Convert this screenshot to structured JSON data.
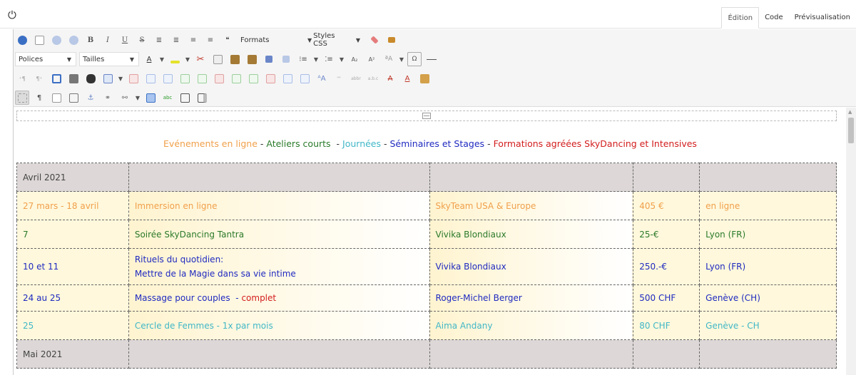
{
  "topbar": {
    "power_icon": "power-icon",
    "tabs": [
      {
        "label": "Édition",
        "active": true
      },
      {
        "label": "Code",
        "active": false
      },
      {
        "label": "Prévisualisation",
        "active": false
      }
    ]
  },
  "toolbar": {
    "formats_label": "Formats",
    "styles_label": "Styles CSS",
    "fonts_label": "Polices",
    "sizes_label": "Tailles",
    "bold": "B",
    "italic": "I",
    "underline": "U",
    "strike": "S",
    "subscript": "A₂",
    "superscript": "A²",
    "omega": "Ω",
    "quote": "❝",
    "pilcrow": "¶",
    "abc": "abc"
  },
  "legend": {
    "online": "Evénements en ligne",
    "short": "Ateliers courts",
    "days": "Journées",
    "seminars": "Séminaires et Stages",
    "trainings": "Formations agréées SkyDancing et Intensives",
    "dash": "-"
  },
  "schedule": {
    "april": "Avril 2021",
    "may": "Mai 2021",
    "rows": [
      {
        "date": "27 mars - 18 avril",
        "title": "Immersion en ligne",
        "host": "SkyTeam USA & Europe",
        "price": "405 €",
        "place": "en ligne"
      },
      {
        "date": "7",
        "title": "Soirée SkyDancing Tantra",
        "host": "Vivika Blondiaux",
        "price": "25-€",
        "place": "Lyon (FR)"
      },
      {
        "date": "10 et 11",
        "title_line1": "Rituels du quotidien:",
        "title_line2": "Mettre de la Magie dans sa vie intime",
        "host": "Vivika Blondiaux",
        "price": "250.-€",
        "place": "Lyon (FR)"
      },
      {
        "date": "24 au 25",
        "title": "Massage pour couples  - ",
        "title_status": "complet",
        "host": "Roger-Michel Berger",
        "price": "500 CHF",
        "place": "Genève (CH)"
      },
      {
        "date": "25",
        "title": "Cercle de Femmes - 1x par mois",
        "host": "Aima Andany",
        "price": "80 CHF",
        "place": "Genève - CH"
      }
    ]
  },
  "colors": {
    "online": "#f0a04b",
    "short": "#2a7a2a",
    "days": "#3fb7c7",
    "seminars": "#1f2ac0",
    "trainings": "#d31d1d",
    "month_bg": "#ddd7d7",
    "row_bg": "#fff8dc"
  }
}
